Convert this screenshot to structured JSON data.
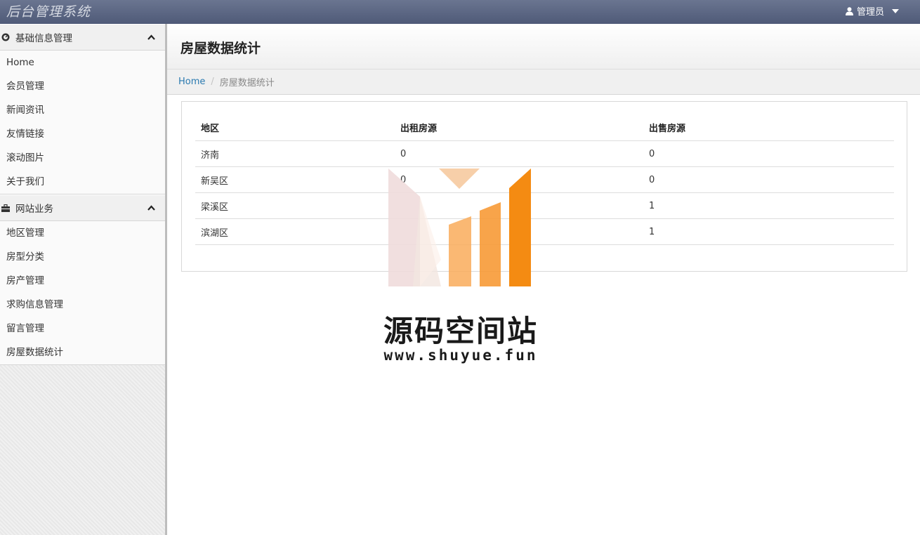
{
  "app": {
    "title": "后台管理系统",
    "user_label": "管理员"
  },
  "sidebar": {
    "groups": [
      {
        "label": "基础信息管理",
        "items": [
          "Home",
          "会员管理",
          "新闻资讯",
          "友情链接",
          "滚动图片",
          "关于我们"
        ]
      },
      {
        "label": "网站业务",
        "items": [
          "地区管理",
          "房型分类",
          "房产管理",
          "求购信息管理",
          "留言管理",
          "房屋数据统计"
        ]
      }
    ]
  },
  "main": {
    "page_title": "房屋数据统计",
    "breadcrumb": {
      "home": "Home",
      "sep": "/",
      "current": "房屋数据统计"
    },
    "table": {
      "headers": [
        "地区",
        "出租房源",
        "出售房源"
      ],
      "rows": [
        [
          "济南",
          "0",
          "0"
        ],
        [
          "新吴区",
          "0",
          "0"
        ],
        [
          "梁溪区",
          "",
          "1"
        ],
        [
          "滨湖区",
          "",
          "1"
        ]
      ]
    }
  },
  "watermark": {
    "title": "源码空间站",
    "url": "www.shuyue.fun",
    "colors": {
      "pale": "#f0dcdc",
      "peach": "#f6c79a",
      "orange_light": "#f9ab5a",
      "orange": "#f48b12"
    }
  }
}
